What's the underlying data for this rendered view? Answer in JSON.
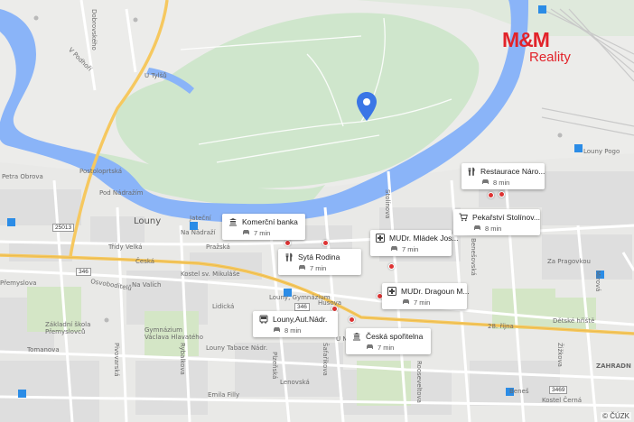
{
  "logo": {
    "brand": "M&M",
    "sub": "Reality"
  },
  "copyright": "© ČÚZK",
  "colors": {
    "river": "#8ab4f8",
    "park": "#cde8cd",
    "urban": "#e6e6e6",
    "road_major": "#ffd67a",
    "brand": "#e2232a",
    "marker": "#3a76e6"
  },
  "location_marker": {
    "icon": "map-pin-icon"
  },
  "pois": [
    {
      "icon": "bank-icon",
      "name": "Komerční banka",
      "time": "7 min"
    },
    {
      "icon": "restaurant-icon",
      "name": "Sytá Rodina",
      "time": "7 min"
    },
    {
      "icon": "medical-icon",
      "name": "MUDr. Mládek Jos...",
      "time": "7 min"
    },
    {
      "icon": "restaurant-icon",
      "name": "Restaurace Náro...",
      "time": "8 min"
    },
    {
      "icon": "shopping-cart-icon",
      "name": "Pekařství Stolínov...",
      "time": "8 min"
    },
    {
      "icon": "medical-icon",
      "name": "MUDr. Dragoun M...",
      "time": "7 min"
    },
    {
      "icon": "bus-icon",
      "name": "Louny,Aut.Nádr.",
      "time": "8 min"
    },
    {
      "icon": "bank-icon",
      "name": "Česká spořitelna",
      "time": "7 min"
    }
  ],
  "route_numbers": [
    "25013",
    "346",
    "346",
    "3469"
  ],
  "streets": [
    "Dobrovského",
    "V Podhoří",
    "U Tylšů",
    "Petra Obrova",
    "Postoloprtská",
    "Pod Nádražím",
    "Louny",
    "Na Nádraží",
    "Pražská",
    "Česká",
    "Jateční",
    "Přemyslova",
    "Na Valích",
    "Osvoboditelů",
    "Třídy Velká",
    "Lidická",
    "Tomanova",
    "Pivovarská",
    "Husova",
    "Emila Filly",
    "28. října",
    "Za Pragovkou",
    "Mírová",
    "ZAHRADN",
    "Louny Pogo",
    "Stolínova",
    "Benešovská",
    "Plzeňská",
    "Rybalkova",
    "Rooseveltova",
    "Šafaříkova",
    "Žižkova",
    "Lenovská",
    "Kostel sv. Mikuláše",
    "Louny, Gymnázium",
    "Louny Tabace Nádr.",
    "Kostel Černá",
    "U Nemocnice",
    "Beneš",
    "Základní škola Přemyslovců",
    "Gymnázium Václava Hlavatého",
    "Dětské hřiště"
  ]
}
